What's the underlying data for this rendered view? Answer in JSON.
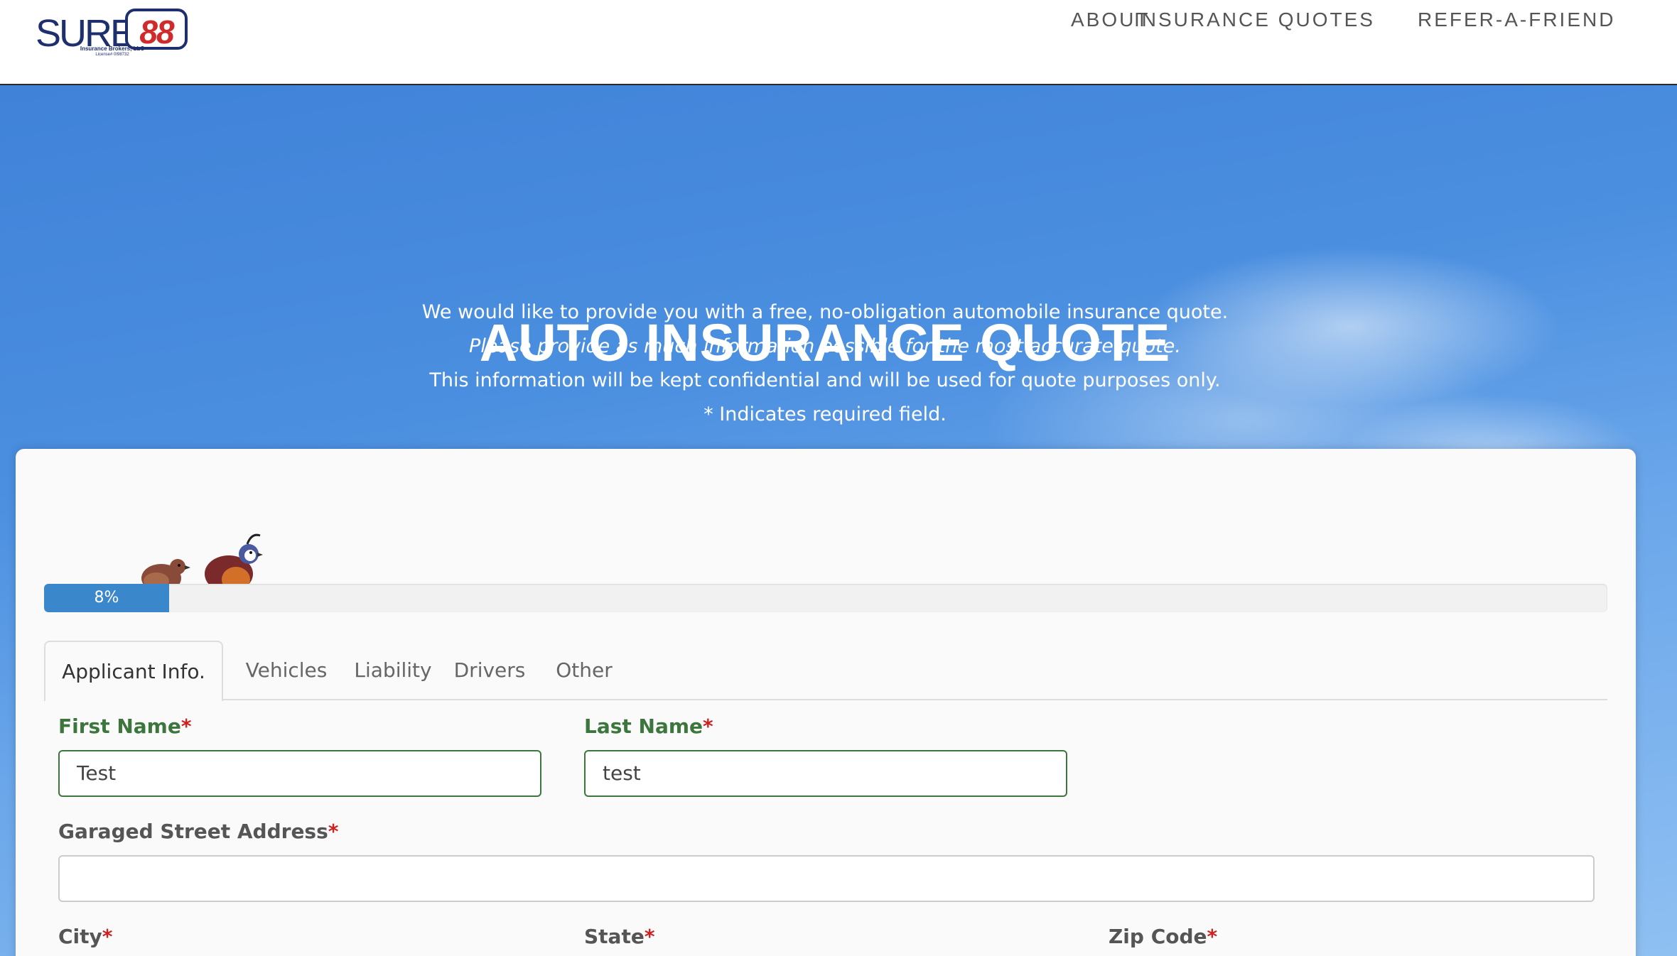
{
  "header": {
    "logo": {
      "brand_text": "SURE",
      "badge_text": "88",
      "subtitle": "Insurance Brokers, LLC",
      "license": "License# 0I98732",
      "colors": {
        "navy": "#1d2f6f",
        "red": "#d22a2a"
      }
    },
    "nav": [
      {
        "label": "ABOUT"
      },
      {
        "label": "INSURANCE QUOTES"
      },
      {
        "label": "REFER-A-FRIEND"
      }
    ]
  },
  "hero": {
    "title": "AUTO INSURANCE QUOTE",
    "lines": [
      "We would like to provide you with a free, no-obligation automobile insurance quote.",
      "Please provide as much information possible for the most accurate quote.",
      "This information will be kept confidential and will be used for quote purposes only.",
      "* Indicates required field."
    ]
  },
  "form": {
    "progress": {
      "value": 0.08,
      "label": "8%",
      "color": "#3b87cc"
    },
    "tabs": [
      {
        "label": "Applicant Info.",
        "active": true
      },
      {
        "label": "Vehicles",
        "active": false
      },
      {
        "label": "Liability",
        "active": false
      },
      {
        "label": "Drivers",
        "active": false
      },
      {
        "label": "Other",
        "active": false
      }
    ],
    "fields": {
      "first_name": {
        "label": "First Name",
        "required_mark": "*",
        "value": "Test"
      },
      "last_name": {
        "label": "Last Name",
        "required_mark": "*",
        "value": "test"
      },
      "street": {
        "label": "Garaged Street Address",
        "required_mark": "*",
        "value": ""
      },
      "city": {
        "label": "City",
        "required_mark": "*"
      },
      "state": {
        "label": "State",
        "required_mark": "*"
      },
      "zip": {
        "label": "Zip Code",
        "required_mark": "*"
      }
    },
    "colors": {
      "valid": "#3c763d",
      "required": "#cc2222"
    }
  }
}
